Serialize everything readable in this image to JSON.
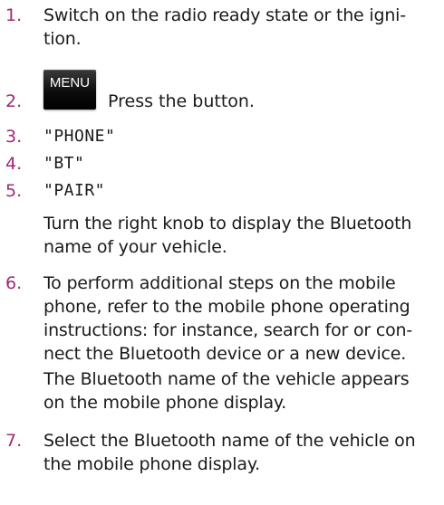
{
  "steps": [
    {
      "number": "1.",
      "text": "Switch on the radio ready state or the igni-\ntion."
    },
    {
      "number": "2.",
      "button_label": "MENU",
      "text": "Press the button."
    },
    {
      "number": "3.",
      "text": "\"PHONE\""
    },
    {
      "number": "4.",
      "text": "\"BT\""
    },
    {
      "number": "5.",
      "text": "\"PAIR\"",
      "note": "Turn the right knob to display the Bluetooth name of your vehicle."
    },
    {
      "number": "6.",
      "text": "To perform additional steps on the mobile phone, refer to the mobile phone operating instructions: for instance, search for or con-nect the Bluetooth device or a new device.",
      "note": "The Bluetooth name of the vehicle appears on the mobile phone display."
    },
    {
      "number": "7.",
      "text": "Select the Bluetooth name of the vehicle on the mobile phone display."
    }
  ],
  "colors": {
    "step_number": "#a0287a",
    "body_text": "#1a1a1a",
    "menu_button_bg": "#0c0c0c"
  }
}
